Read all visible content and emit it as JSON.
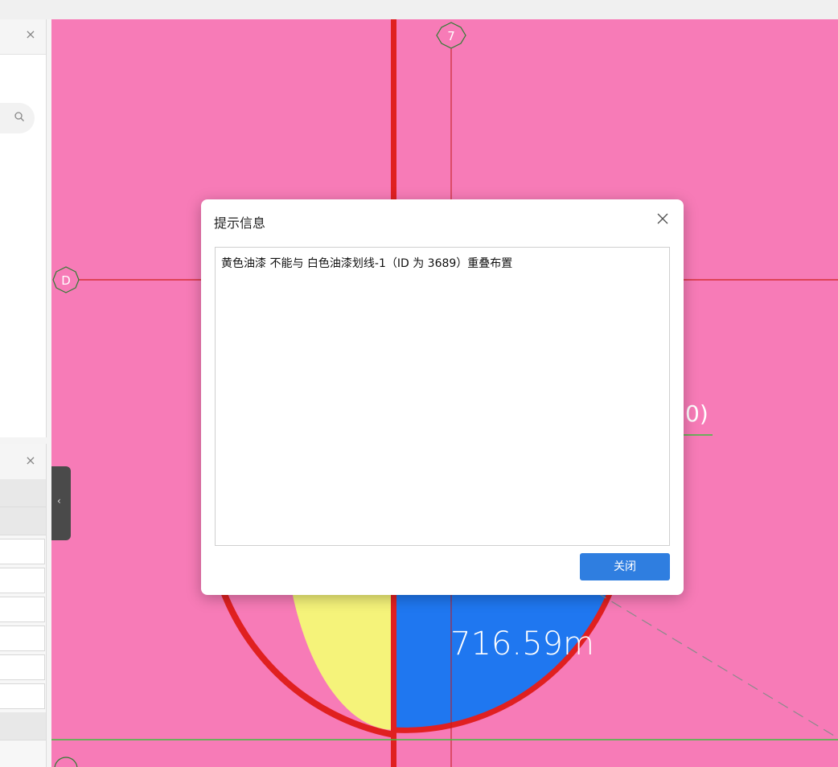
{
  "colors": {
    "canvas_bg": "#f77bb7",
    "axis_red": "#e02020",
    "grid_green": "#3fbf3f",
    "yellow_fill": "#f5f37a",
    "blue_fill": "#1f77f0",
    "button_blue": "#2f7ee0"
  },
  "icons": {
    "panel_close": "×",
    "search": "search-icon",
    "collapse": "‹"
  },
  "canvas": {
    "grid_label_7": "7",
    "grid_label_d": "D",
    "measure_text": "716.59m",
    "partial_text": "0)"
  },
  "dialog": {
    "title": "提示信息",
    "close_glyph": "×",
    "message": "黄色油漆 不能与 白色油漆划线-1（ID 为 3689）重叠布置",
    "ok_label": "关闭"
  }
}
